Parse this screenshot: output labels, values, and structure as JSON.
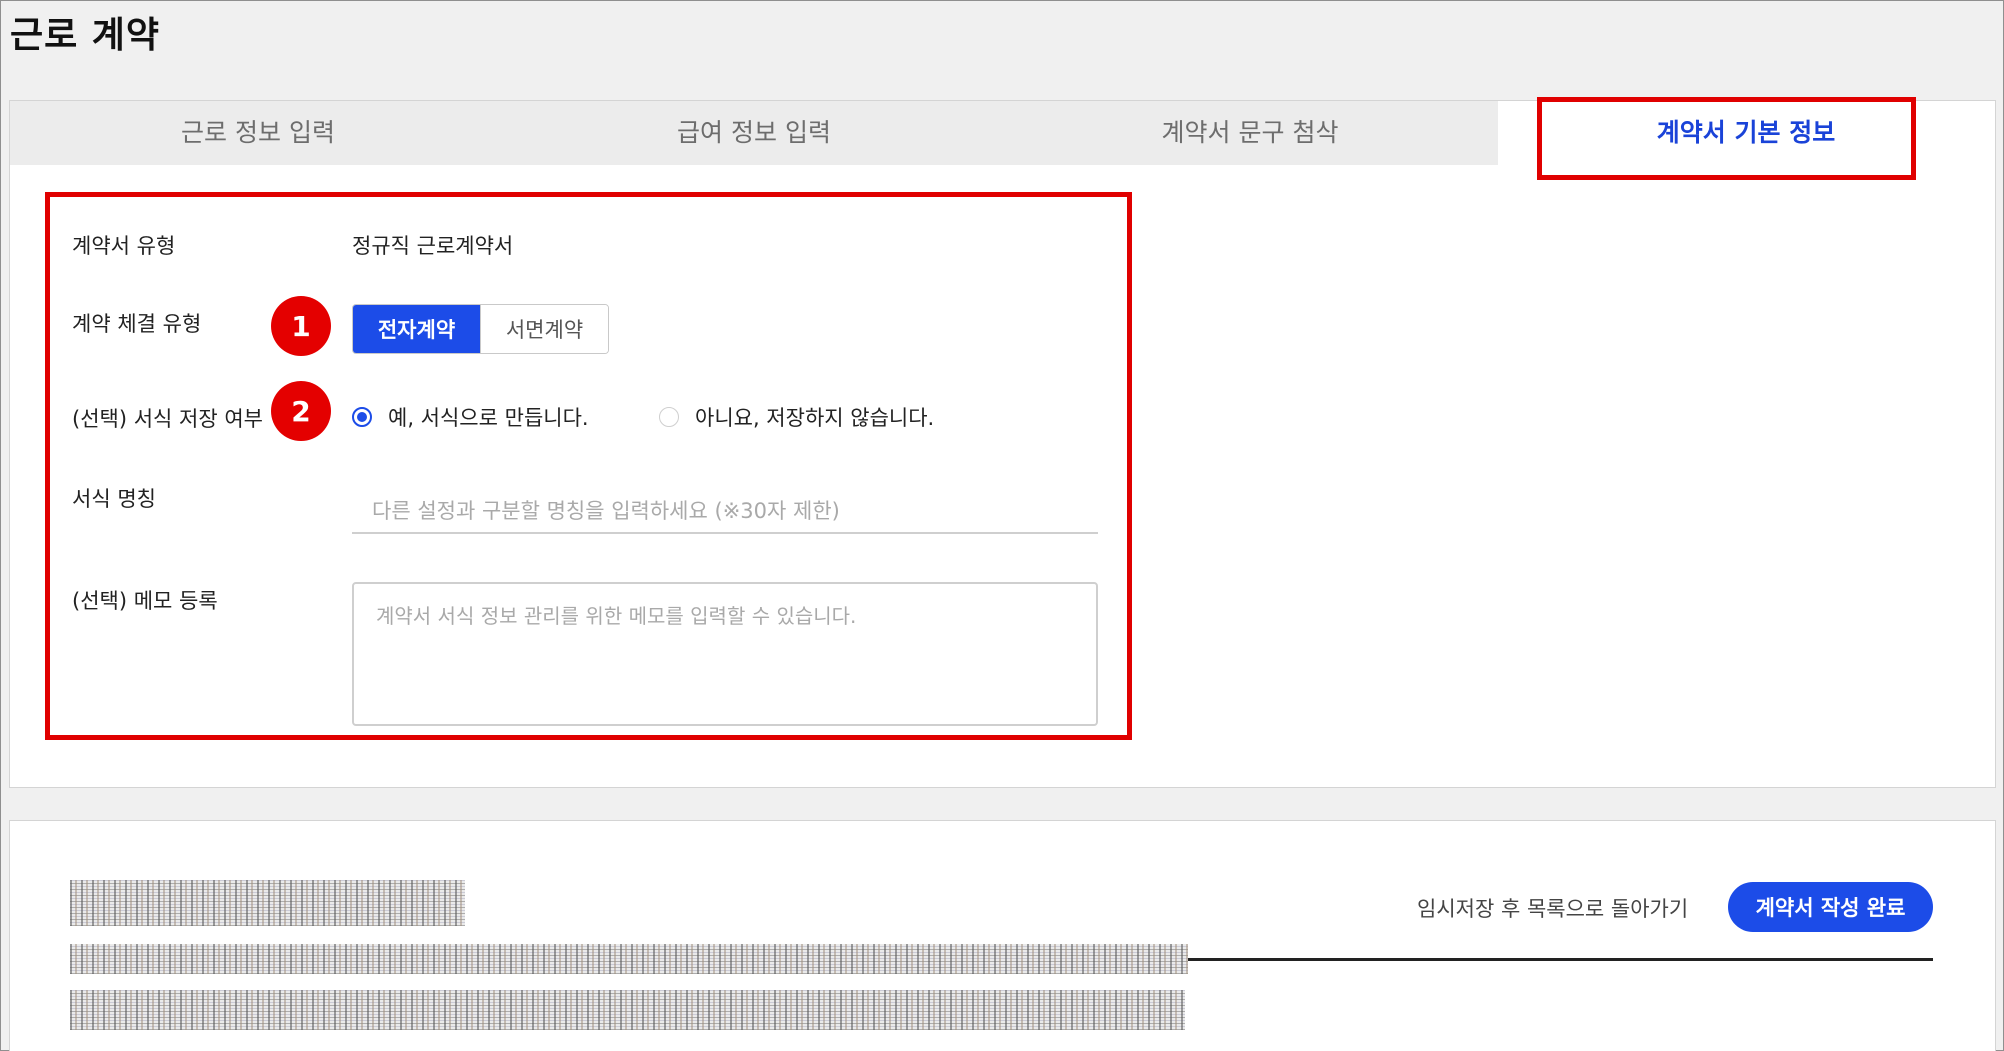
{
  "page": {
    "title": "근로 계약"
  },
  "tabs": [
    {
      "label": "근로 정보 입력"
    },
    {
      "label": "급여 정보 입력"
    },
    {
      "label": "계약서 문구 첨삭"
    },
    {
      "label": "계약서 기본 정보"
    }
  ],
  "active_tab_index": 3,
  "form": {
    "contract_type": {
      "label": "계약서 유형",
      "value": "정규직 근로계약서"
    },
    "signing_type": {
      "label": "계약 체결 유형",
      "options": [
        "전자계약",
        "서면계약"
      ],
      "selected": "전자계약"
    },
    "save_template": {
      "label": "(선택) 서식 저장 여부",
      "options": [
        "예, 서식으로 만듭니다.",
        "아니요, 저장하지 않습니다."
      ],
      "selected": "예, 서식으로 만듭니다."
    },
    "template_name": {
      "label": "서식 명칭",
      "placeholder": "다른 설정과 구분할 명칭을 입력하세요 (※30자 제한)"
    },
    "memo": {
      "label": "(선택) 메모 등록",
      "placeholder": "계약서 서식 정보 관리를 위한 메모를 입력할 수 있습니다."
    }
  },
  "annotations": {
    "badge_1": "1",
    "badge_2": "2",
    "color": "#e00000"
  },
  "footer": {
    "back_link": "임시저장 후 목록으로 돌아가기",
    "complete_button": "계약서 작성 완료"
  },
  "colors": {
    "accent": "#1c4ce8",
    "highlight": "#e00000",
    "tab_inactive_bg": "#ececec"
  },
  "icons": [
    "radio-selected-icon",
    "radio-unselected-icon"
  ]
}
